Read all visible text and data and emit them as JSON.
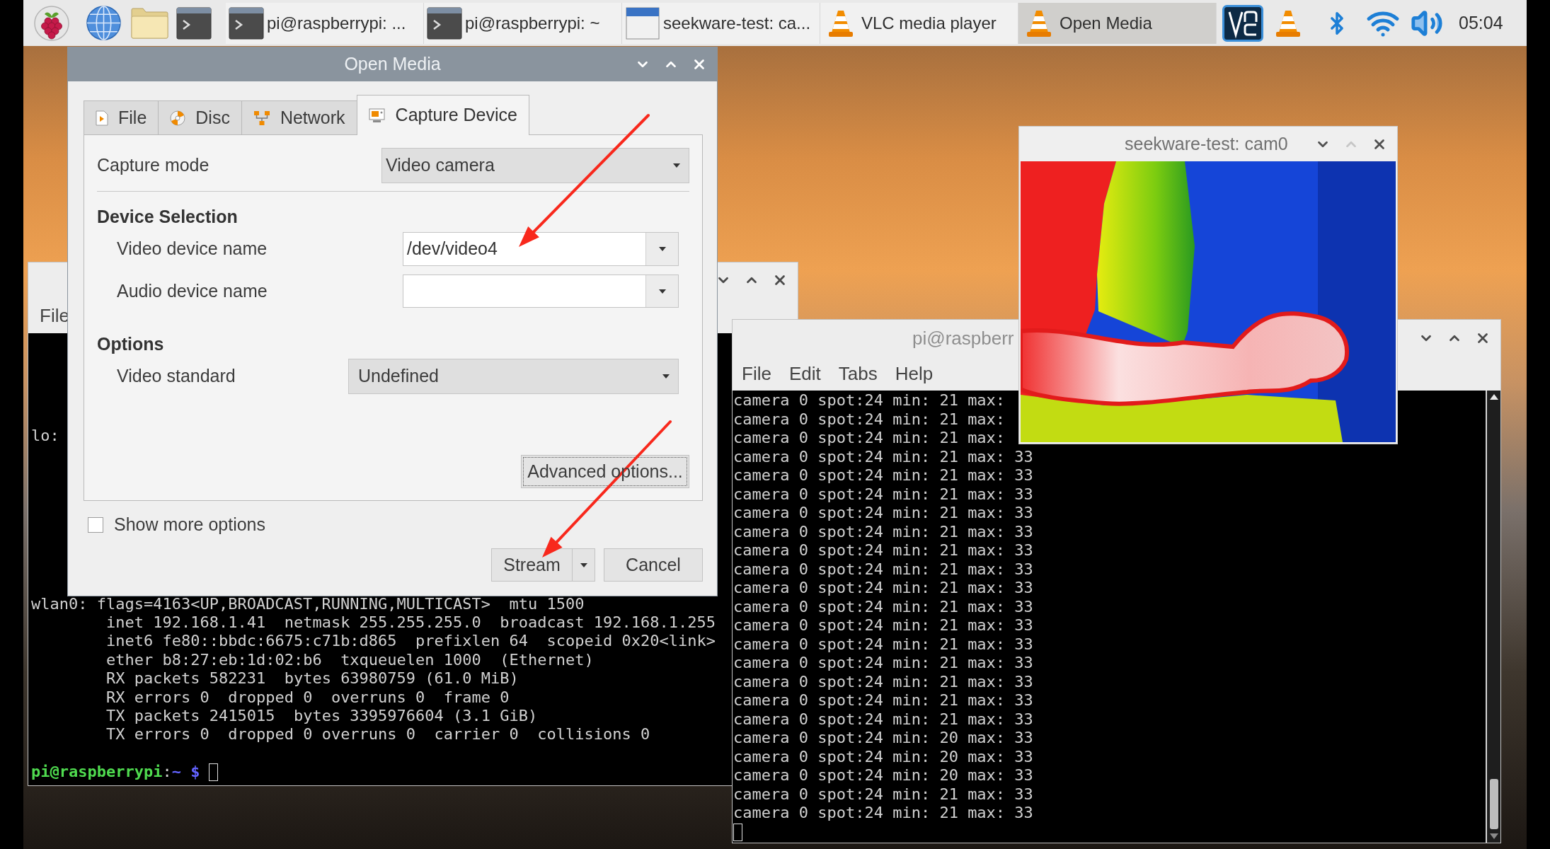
{
  "taskbar": {
    "tasks": [
      {
        "kind": "terminal",
        "label": "pi@raspberrypi: ...",
        "selected": false
      },
      {
        "kind": "terminal",
        "label": "pi@raspberrypi: ~",
        "selected": false
      },
      {
        "kind": "window",
        "label": "seekware-test: ca...",
        "selected": false
      },
      {
        "kind": "vlc",
        "label": "VLC media player",
        "selected": false
      },
      {
        "kind": "vlc",
        "label": "Open Media",
        "selected": true
      }
    ],
    "clock": "05:04"
  },
  "open_media_dialog": {
    "title": "Open Media",
    "tabs": [
      {
        "kind": "file",
        "label": "File",
        "selected": false
      },
      {
        "kind": "disc",
        "label": "Disc",
        "selected": false
      },
      {
        "kind": "network",
        "label": "Network",
        "selected": false
      },
      {
        "kind": "capture",
        "label": "Capture Device",
        "selected": true
      }
    ],
    "capture_mode": {
      "label": "Capture mode",
      "value": "Video camera"
    },
    "device_selection": {
      "heading": "Device Selection",
      "fields": [
        {
          "label": "Video device name",
          "value": "/dev/video4"
        },
        {
          "label": "Audio device name"
        }
      ]
    },
    "options": {
      "heading": "Options",
      "fields": [
        {
          "label": "Video standard",
          "value": "Undefined"
        }
      ]
    },
    "advanced_button": {
      "label": "Advanced options...",
      "focused": true
    },
    "show_more_options": {
      "label": "Show more options",
      "checked": false
    },
    "buttons": [
      {
        "kind": "split",
        "label": "Stream"
      },
      {
        "kind": "plain",
        "label": "Cancel"
      }
    ]
  },
  "back_terminal": {
    "menu": [
      "File"
    ],
    "output_upper": [
      {
        "text": "lo:"
      }
    ],
    "output_lower": [
      {
        "text": "wlan0: flags=4163<UP,BROADCAST,RUNNING,MULTICAST>  mtu 1500",
        "children": [
          {
            "text": "inet 192.168.1.41  netmask 255.255.255.0  broadcast 192.168.1.255"
          },
          {
            "text": "inet6 fe80::bbdc:6675:c71b:d865  prefixlen 64  scopeid 0x20<link>"
          },
          {
            "text": "ether b8:27:eb:1d:02:b6  txqueuelen 1000  (Ethernet)"
          },
          {
            "text": "RX packets 582231  bytes 63980759 (61.0 MiB)"
          },
          {
            "text": "RX errors 0  dropped 0  overruns 0  frame 0"
          },
          {
            "text": "TX packets 2415015  bytes 3395976604 (3.1 GiB)"
          },
          {
            "text": "TX errors 0  dropped 0 overruns 0  carrier 0  collisions 0"
          }
        ]
      }
    ],
    "prompt": [
      {
        "kind": "user",
        "text": "pi@raspberrypi"
      },
      {
        "kind": "plain",
        "text": ":"
      },
      {
        "kind": "path",
        "text": "~ $"
      }
    ]
  },
  "front_terminal": {
    "title": "pi@raspberr",
    "menu": [
      "File",
      "Edit",
      "Tabs",
      "Help"
    ],
    "output": [
      "camera 0 spot:24 min: 21 max:",
      "camera 0 spot:24 min: 21 max:",
      "camera 0 spot:24 min: 21 max:",
      "camera 0 spot:24 min: 21 max: 33",
      "camera 0 spot:24 min: 21 max: 33",
      "camera 0 spot:24 min: 21 max: 33",
      "camera 0 spot:24 min: 21 max: 33",
      "camera 0 spot:24 min: 21 max: 33",
      "camera 0 spot:24 min: 21 max: 33",
      "camera 0 spot:24 min: 21 max: 33",
      "camera 0 spot:24 min: 21 max: 33",
      "camera 0 spot:24 min: 21 max: 33",
      "camera 0 spot:24 min: 21 max: 33",
      "camera 0 spot:24 min: 21 max: 33",
      "camera 0 spot:24 min: 21 max: 33",
      "camera 0 spot:24 min: 21 max: 33",
      "camera 0 spot:24 min: 21 max: 33",
      "camera 0 spot:24 min: 21 max: 33",
      "camera 0 spot:24 min: 20 max: 33",
      "camera 0 spot:24 min: 20 max: 33",
      "camera 0 spot:24 min: 20 max: 33",
      "camera 0 spot:24 min: 21 max: 33",
      "camera 0 spot:24 min: 21 max: 33"
    ]
  },
  "camera_window": {
    "title": "seekware-test: cam0",
    "maximize_disabled": true
  }
}
